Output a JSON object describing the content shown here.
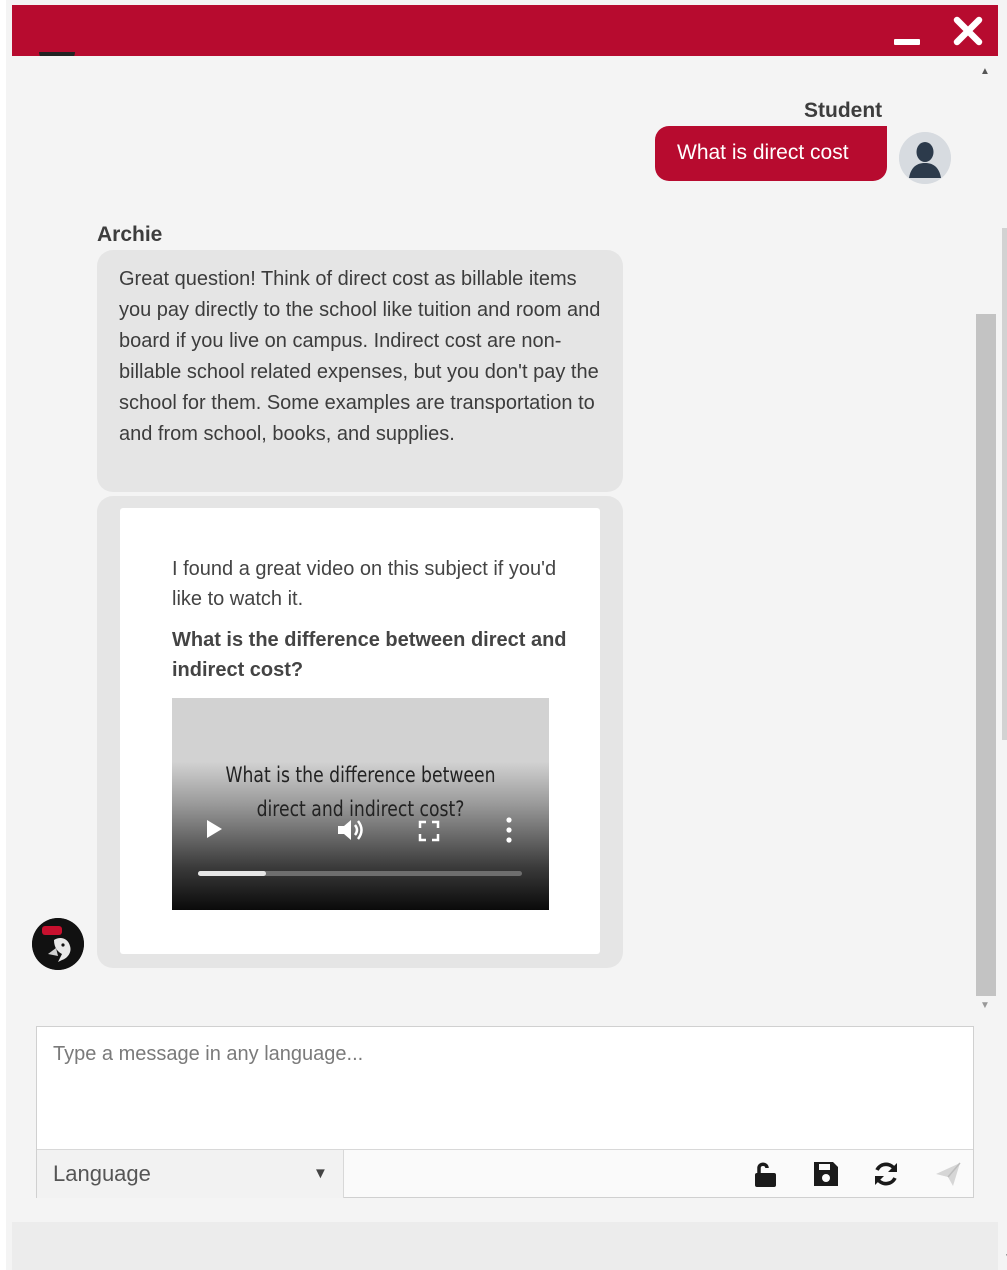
{
  "titlebar": {
    "minimize_icon": "minimize-icon",
    "close_icon": "close-icon",
    "color": "#b70b2f"
  },
  "messages": {
    "student": {
      "sender": "Student",
      "text": "What is direct cost"
    },
    "archie": {
      "sender": "Archie",
      "text": "Great question! Think of direct cost as billable items you pay directly to the school like tuition and room and board if you live on campus. Indirect cost are non-billable school related expenses, but you don't pay the school for them. Some examples are transportation to and from school, books, and supplies."
    },
    "card": {
      "intro": "I found a great video on this subject if you'd like to watch it.",
      "title": "What is the difference between direct and indirect cost?",
      "video": {
        "overlay_title": "What is the difference between direct and indirect cost?",
        "progress": 0.21
      }
    }
  },
  "composer": {
    "placeholder": "Type a message in any language...",
    "value": "",
    "language_label": "Language",
    "icons": [
      "unlock-icon",
      "save-icon",
      "refresh-icon",
      "send-icon"
    ]
  }
}
